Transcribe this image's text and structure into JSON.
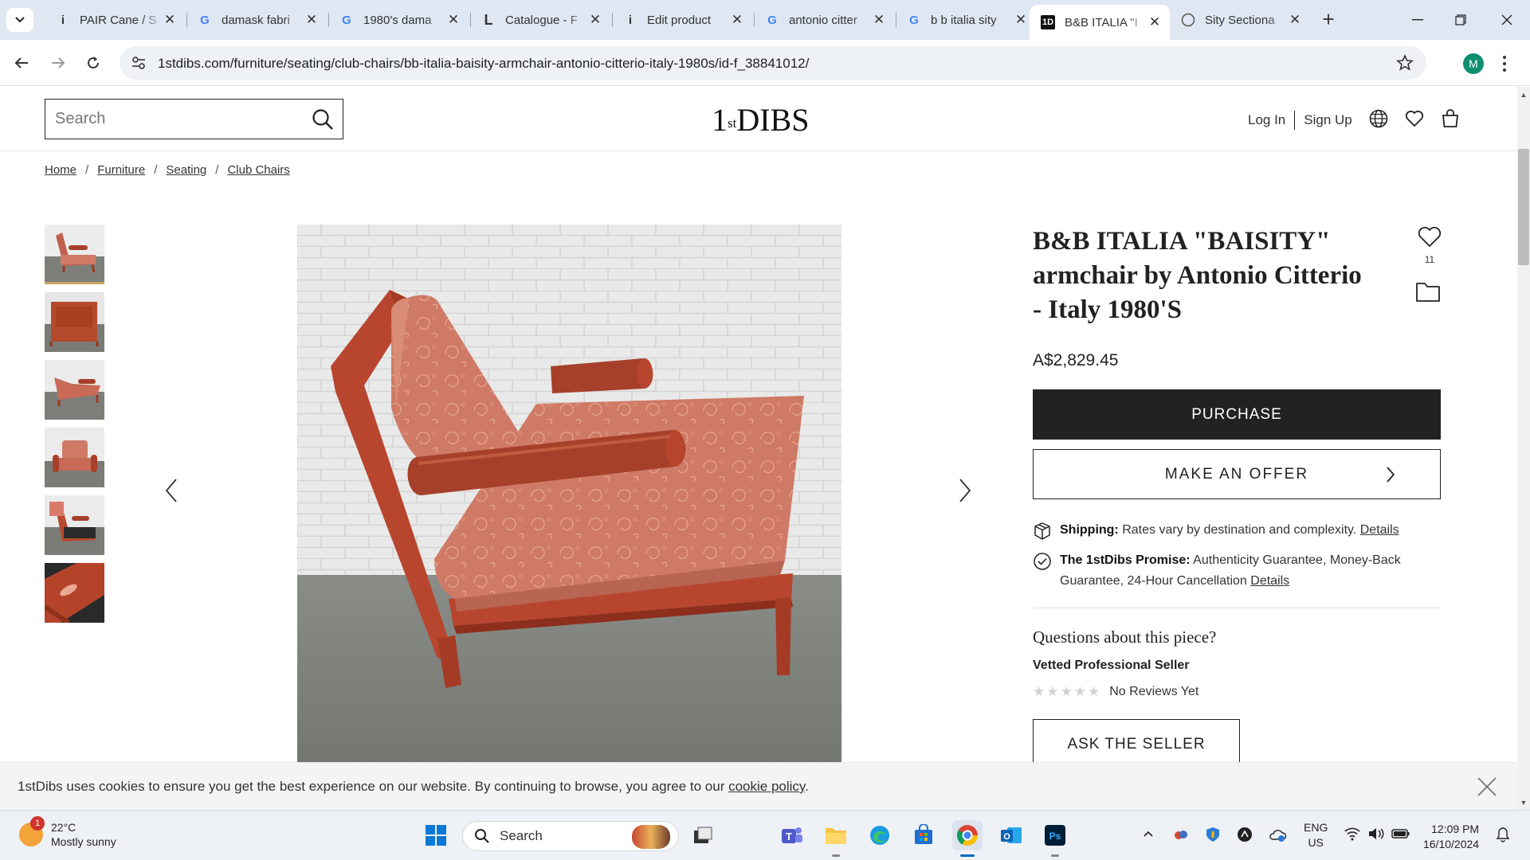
{
  "browser": {
    "tabs": [
      {
        "title": "PAIR Cane / S",
        "favicon": "info-icon"
      },
      {
        "title": "damask fabri",
        "favicon": "google-icon"
      },
      {
        "title": "1980's dama",
        "favicon": "google-icon"
      },
      {
        "title": "Catalogue - F",
        "favicon": "l-icon"
      },
      {
        "title": "Edit product",
        "favicon": "info-icon"
      },
      {
        "title": "antonio citter",
        "favicon": "google-icon"
      },
      {
        "title": "b b italia sity",
        "favicon": "google-icon"
      },
      {
        "title": "B&B ITALIA \"I",
        "favicon": "1stdibs-icon",
        "active": true
      },
      {
        "title": "Sity Sectiona",
        "favicon": "globe-icon"
      }
    ],
    "url": "1stdibs.com/furniture/seating/club-chairs/bb-italia-baisity-armchair-antonio-citterio-italy-1980s/id-f_38841012/",
    "profile_initial": "M"
  },
  "site": {
    "search_placeholder": "Search",
    "logo_prefix": "1",
    "logo_sup": "st",
    "logo_text": "DIBS",
    "login": "Log In",
    "signup": "Sign Up"
  },
  "breadcrumb": [
    "Home",
    "Furniture",
    "Seating",
    "Club Chairs"
  ],
  "product": {
    "title": "B&B ITALIA \"BAISITY\" armchair by Antonio Citterio - Italy 1980'S",
    "favorite_count": "11",
    "price": "A$2,829.45",
    "purchase_label": "PURCHASE",
    "offer_label": "MAKE AN OFFER",
    "shipping_label": "Shipping:",
    "shipping_text": "Rates vary by destination and complexity.",
    "shipping_link": "Details",
    "promise_label": "The 1stDibs Promise:",
    "promise_text": "Authenticity Guarantee, Money-Back Guarantee, 24-Hour Cancellation",
    "promise_link": "Details",
    "questions_title": "Questions about this piece?",
    "seller_type": "Vetted Professional Seller",
    "reviews_text": "No Reviews Yet",
    "ask_label": "ASK THE SELLER"
  },
  "cookie": {
    "text": "1stDibs uses cookies to ensure you get the best experience on our website. By continuing to browse, you agree to our",
    "link": "cookie policy",
    "end": "."
  },
  "taskbar": {
    "temp": "22°C",
    "weather": "Mostly sunny",
    "weather_badge": "1",
    "search": "Search",
    "lang_top": "ENG",
    "lang_bottom": "US",
    "time": "12:09 PM",
    "date": "16/10/2024"
  },
  "colors": {
    "chair_frame": "#b8452e",
    "cushion": "#cf7a66",
    "wall": "#e9e9e9",
    "floor": "#7b7d79",
    "accent_dark": "#222222"
  }
}
